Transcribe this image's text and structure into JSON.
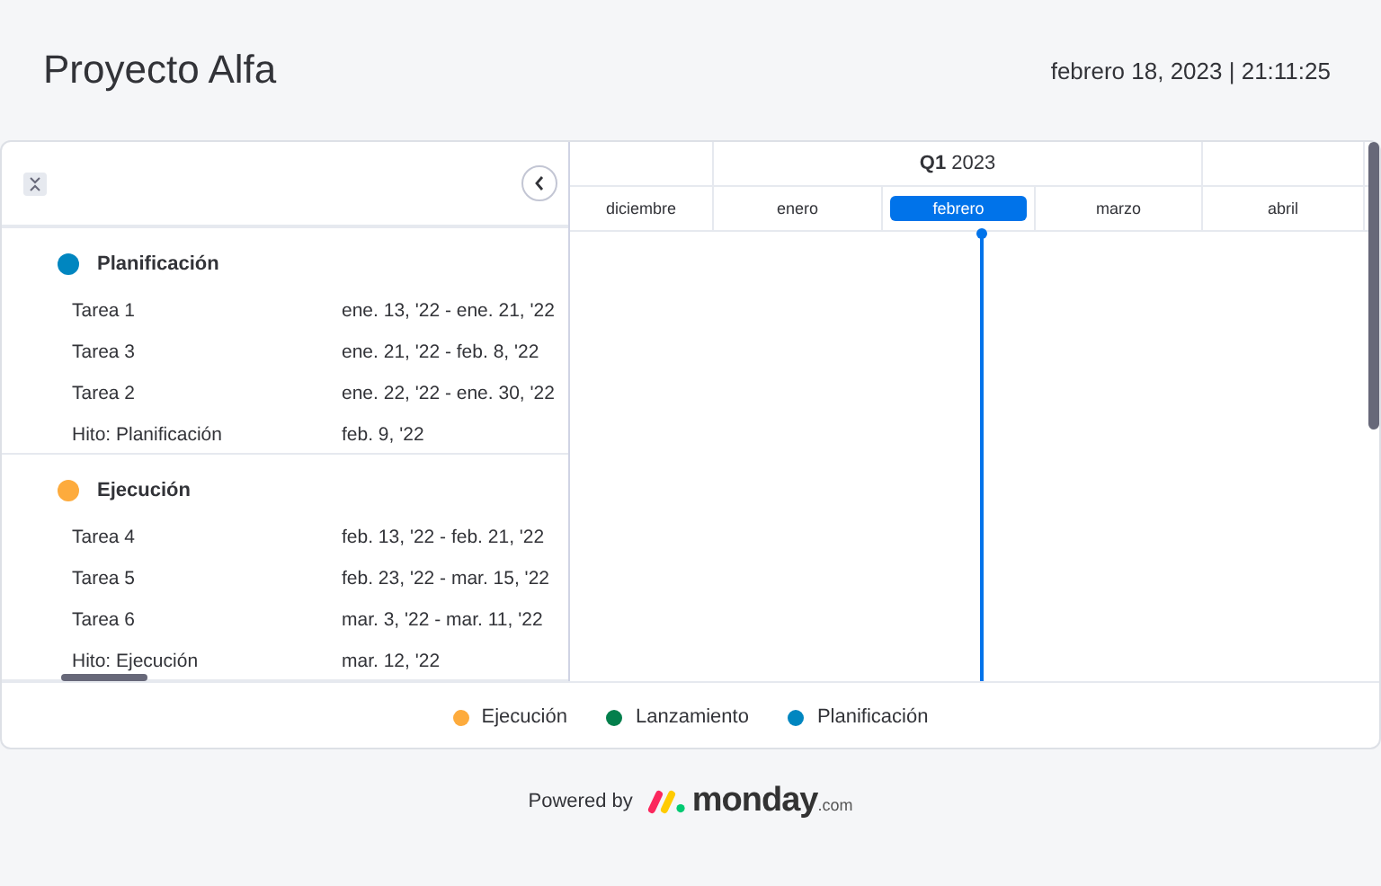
{
  "header": {
    "title": "Proyecto Alfa",
    "datetime": "febrero 18, 2023 | 21:11:25"
  },
  "timeline": {
    "quarter": "**Q1** 2023",
    "months": [
      {
        "label": "diciembre",
        "selected": false
      },
      {
        "label": "enero",
        "selected": false
      },
      {
        "label": "febrero",
        "selected": true
      },
      {
        "label": "marzo",
        "selected": false
      },
      {
        "label": "abril",
        "selected": false
      }
    ]
  },
  "groups": [
    {
      "name": "Planificación",
      "color": "#0086c0",
      "tasks": [
        {
          "name": "Tarea 1",
          "dates": "ene. 13, '22 - ene. 21, '22"
        },
        {
          "name": "Tarea 3",
          "dates": "ene. 21, '22 - feb. 8, '22"
        },
        {
          "name": "Tarea 2",
          "dates": "ene. 22, '22 - ene. 30, '22"
        },
        {
          "name": "Hito: Planificación",
          "dates": "feb. 9, '22"
        }
      ]
    },
    {
      "name": "Ejecución",
      "color": "#fdab3d",
      "tasks": [
        {
          "name": "Tarea 4",
          "dates": "feb. 13, '22 - feb. 21, '22"
        },
        {
          "name": "Tarea 5",
          "dates": "feb. 23, '22 - mar. 15, '22"
        },
        {
          "name": "Tarea 6",
          "dates": "mar. 3, '22 - mar. 11, '22"
        },
        {
          "name": "Hito: Ejecución",
          "dates": "mar. 12, '22"
        }
      ]
    }
  ],
  "legend": [
    {
      "label": "Ejecución",
      "color": "#fdab3d"
    },
    {
      "label": "Lanzamiento",
      "color": "#037f4c"
    },
    {
      "label": "Planificación",
      "color": "#0086c0"
    }
  ],
  "footer": {
    "powered_by": "Powered by",
    "brand": "monday",
    "brand_suffix": ".com"
  }
}
